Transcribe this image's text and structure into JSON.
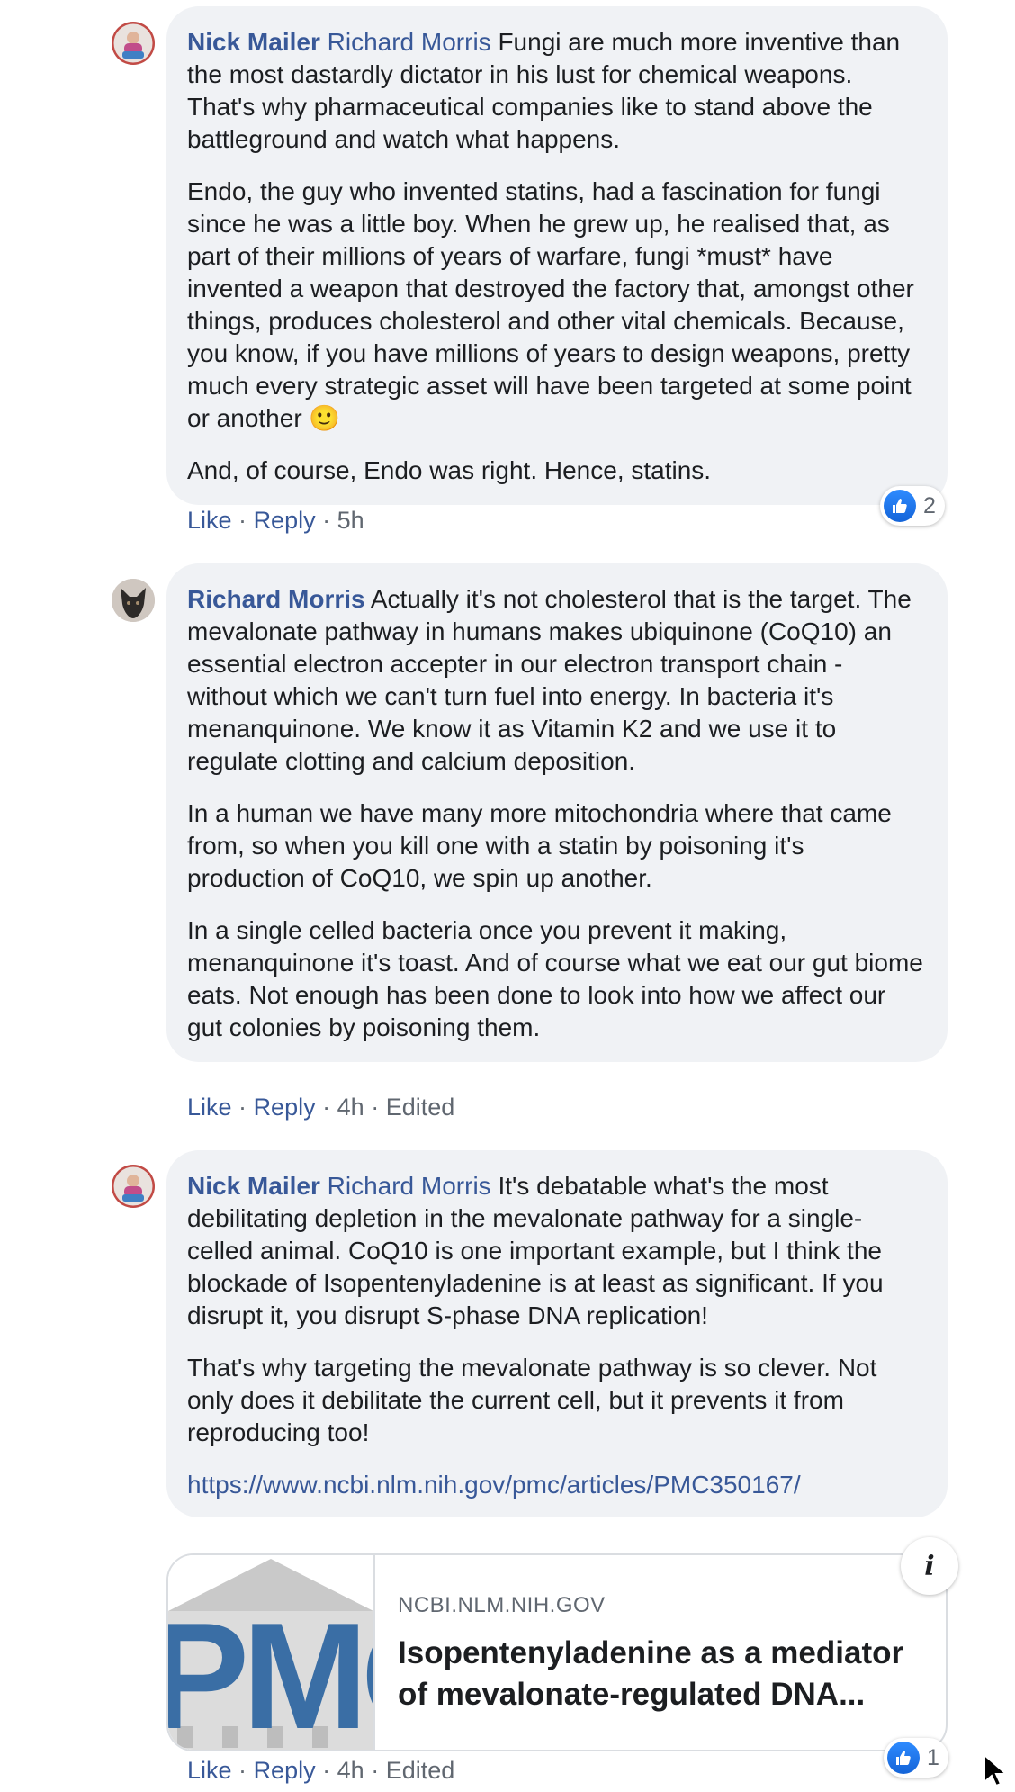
{
  "comments": [
    {
      "author": "Nick Mailer",
      "mention": "Richard Morris",
      "paragraphs": [
        "Fungi are much more inventive than the most dastardly dictator in his lust for chemical weapons. That's why pharmaceutical companies like to stand above the battleground and watch what happens.",
        "Endo, the guy who invented statins, had a fascination for fungi since he was a little boy. When he grew up, he realised that, as part of their millions of years of warfare, fungi *must* have invented a weapon that destroyed the factory that, amongst other things, produces cholesterol and other vital chemicals. Because, you know, if you have millions of years to design weapons, pretty much every strategic asset will have been targeted at some point or another",
        "And, of course, Endo was right. Hence, statins."
      ],
      "emoji": "🙂",
      "like_label": "Like",
      "reply_label": "Reply",
      "time": "5h",
      "reaction_count": "2"
    },
    {
      "author": "Richard Morris",
      "paragraphs": [
        "Actually it's not cholesterol that is the target. The mevalonate pathway in humans makes ubiquinone (CoQ10) an essential electron accepter in our electron transport chain - without which we can't turn fuel into energy. In bacteria it's menanquinone. We know it as Vitamin K2 and we use it to regulate clotting and calcium deposition.",
        "In a human we have many more mitochondria where that came from, so when you kill one with a statin by poisoning it's production of CoQ10, we spin up another.",
        "In a single celled bacteria once you prevent it making, menanquinone it's toast. And of course what we eat our gut biome eats. Not enough has been done to look into how we affect our gut colonies by poisoning them."
      ],
      "like_label": "Like",
      "reply_label": "Reply",
      "time": "4h",
      "edited": "Edited"
    },
    {
      "author": "Nick Mailer",
      "mention": "Richard Morris",
      "paragraphs": [
        "It's debatable what's the most debilitating depletion in the mevalonate pathway for a single-celled animal. CoQ10 is one important example, but I think the blockade of Isopentenyladenine is at least as significant. If you disrupt it, you disrupt S-phase DNA replication!",
        "That's why targeting the mevalonate pathway is so clever. Not only does it debilitate the current cell, but it prevents it from reproducing too!"
      ],
      "link": "https://www.ncbi.nlm.nih.gov/pmc/articles/PMC350167/",
      "card": {
        "domain": "NCBI.NLM.NIH.GOV",
        "title": "Isopentenyladenine as a mediator of mevalonate-regulated DNA...",
        "thumb_text": "PMC"
      },
      "info_label": "i",
      "like_label": "Like",
      "reply_label": "Reply",
      "time": "4h",
      "edited": "Edited",
      "reaction_count": "1"
    }
  ],
  "separator": "·",
  "colors": {
    "link": "#385898",
    "bubble": "#f0f2f5",
    "meta": "#606770",
    "like_blue": "#1877f2"
  }
}
